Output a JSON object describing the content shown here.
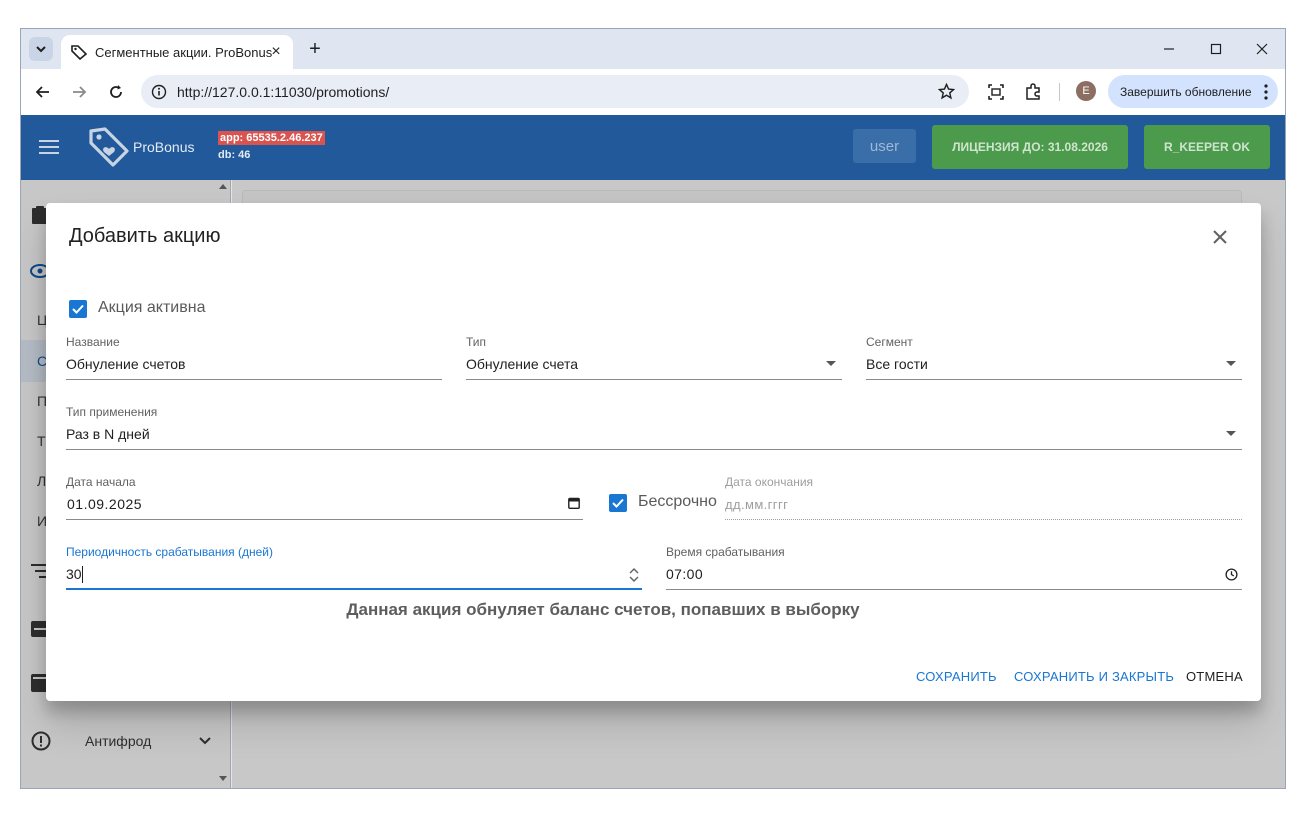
{
  "browser": {
    "tab_title": "Сегментные акции. ProBonus",
    "new_tab": "+",
    "tab_close": "×",
    "url": "http://127.0.0.1:11030/promotions/",
    "avatar_letter": "E",
    "update_label": "Завершить обновление"
  },
  "app": {
    "logo_text": "ProBonus",
    "app_version": "app: 65535.2.46.237",
    "db_version": "db: 46",
    "user_label": "user",
    "license_label": "ЛИЦЕНЗИЯ ДО: 31.08.2026",
    "rkeeper_label": "R_KEEPER OK",
    "colors": {
      "appbar": "#21599a",
      "green": "#4c9a4b",
      "accent": "#1976d2",
      "version_bg": "#d9534f"
    }
  },
  "sidebar": {
    "items": [
      {
        "icon": "clipboard-icon",
        "label": ""
      },
      {
        "icon": "tag-eye-icon",
        "label": ""
      },
      {
        "icon": "",
        "label": "Ц"
      },
      {
        "icon": "",
        "label": "С"
      },
      {
        "icon": "",
        "label": "П"
      },
      {
        "icon": "",
        "label": "Т"
      },
      {
        "icon": "",
        "label": "Л"
      },
      {
        "icon": "",
        "label": "И"
      },
      {
        "icon": "list-icon",
        "label": ""
      },
      {
        "icon": "card-icon",
        "label": ""
      },
      {
        "icon": "wallet-icon",
        "label": ""
      },
      {
        "icon": "alert-circle-icon",
        "label": "Антифрод"
      }
    ]
  },
  "dialog": {
    "title": "Добавить акцию",
    "active_label": "Акция активна",
    "active_checked": true,
    "name": {
      "label": "Название",
      "value": "Обнуление счетов"
    },
    "type": {
      "label": "Тип",
      "value": "Обнуление счета"
    },
    "segment": {
      "label": "Сегмент",
      "value": "Все гости"
    },
    "apply_type": {
      "label": "Тип применения",
      "value": "Раз в N дней"
    },
    "start_date": {
      "label": "Дата начала",
      "value": "01.09.2025"
    },
    "unlimited": {
      "label": "Бессрочно",
      "checked": true
    },
    "end_date": {
      "label": "Дата окончания",
      "placeholder": "дд.мм.гггг"
    },
    "period": {
      "label": "Периодичность срабатывания (дней)",
      "value": "30"
    },
    "time": {
      "label": "Время срабатывания",
      "value": "07:00"
    },
    "info": "Данная акция обнуляет баланс счетов, попавших в выборку",
    "actions": {
      "save": "СОХРАНИТЬ",
      "save_close": "СОХРАНИТЬ И ЗАКРЫТЬ",
      "cancel": "ОТМЕНА"
    }
  }
}
